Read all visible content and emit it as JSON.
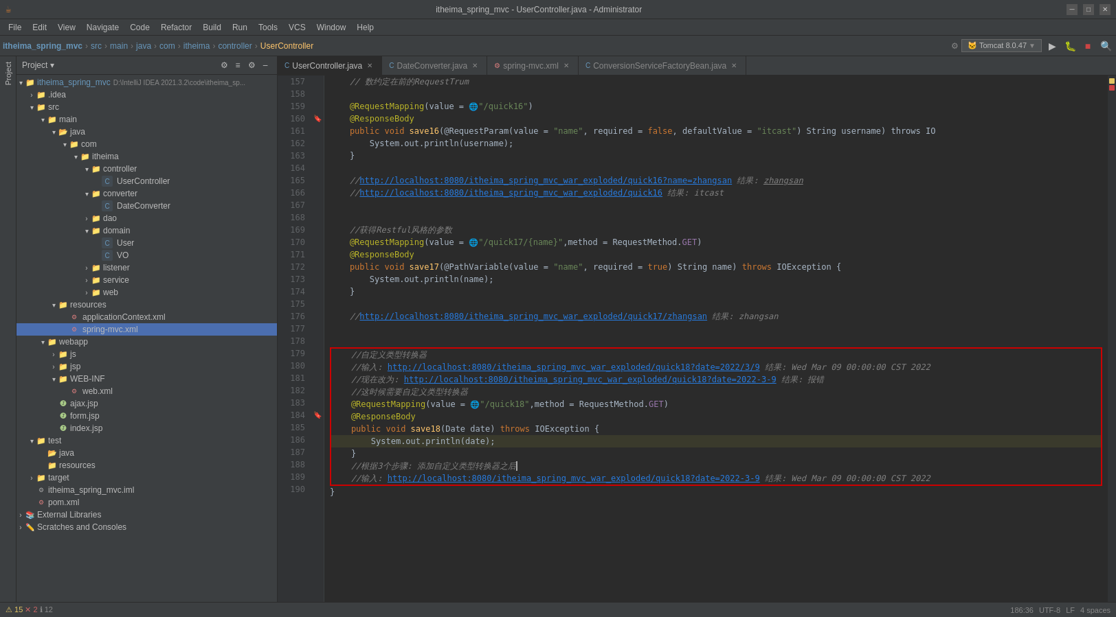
{
  "titleBar": {
    "title": "itheima_spring_mvc - UserController.java - Administrator",
    "minBtn": "─",
    "maxBtn": "□",
    "closeBtn": "✕"
  },
  "menuBar": {
    "items": [
      "File",
      "Edit",
      "View",
      "Navigate",
      "Code",
      "Refactor",
      "Build",
      "Run",
      "Tools",
      "VCS",
      "Window",
      "Help"
    ]
  },
  "toolbar": {
    "breadcrumb": [
      "itheima_spring_mvc",
      "src",
      "main",
      "java",
      "com",
      "itheima",
      "controller",
      "UserController"
    ],
    "tomcat": "Tomcat 8.0.47"
  },
  "sidebar": {
    "title": "Project",
    "tree": [
      {
        "id": "itheima_spring_mvc",
        "label": "itheima_spring_mvc",
        "indent": 0,
        "type": "project",
        "expanded": true,
        "suffix": " D:\\IntelliJ IDEA 2021.3.2\\code\\itheima_sp..."
      },
      {
        "id": "idea",
        "label": ".idea",
        "indent": 1,
        "type": "folder",
        "expanded": false
      },
      {
        "id": "src",
        "label": "src",
        "indent": 1,
        "type": "folder",
        "expanded": true
      },
      {
        "id": "main",
        "label": "main",
        "indent": 2,
        "type": "folder",
        "expanded": true
      },
      {
        "id": "java",
        "label": "java",
        "indent": 3,
        "type": "folder-src",
        "expanded": true
      },
      {
        "id": "com",
        "label": "com",
        "indent": 4,
        "type": "folder",
        "expanded": true
      },
      {
        "id": "itheima",
        "label": "itheima",
        "indent": 5,
        "type": "folder",
        "expanded": true
      },
      {
        "id": "controller",
        "label": "controller",
        "indent": 6,
        "type": "folder",
        "expanded": true
      },
      {
        "id": "UserController",
        "label": "UserController",
        "indent": 7,
        "type": "java-class",
        "selected": false
      },
      {
        "id": "converter",
        "label": "converter",
        "indent": 6,
        "type": "folder",
        "expanded": true
      },
      {
        "id": "DateConverter",
        "label": "DateConverter",
        "indent": 7,
        "type": "java-class"
      },
      {
        "id": "dao",
        "label": "dao",
        "indent": 6,
        "type": "folder",
        "expanded": false
      },
      {
        "id": "domain",
        "label": "domain",
        "indent": 6,
        "type": "folder",
        "expanded": true
      },
      {
        "id": "User",
        "label": "User",
        "indent": 7,
        "type": "java-class"
      },
      {
        "id": "VO",
        "label": "VO",
        "indent": 7,
        "type": "java-class"
      },
      {
        "id": "listener",
        "label": "listener",
        "indent": 6,
        "type": "folder",
        "expanded": false
      },
      {
        "id": "service",
        "label": "service",
        "indent": 6,
        "type": "folder",
        "expanded": false
      },
      {
        "id": "web",
        "label": "web",
        "indent": 6,
        "type": "folder",
        "expanded": false
      },
      {
        "id": "resources",
        "label": "resources",
        "indent": 3,
        "type": "folder-res",
        "expanded": true
      },
      {
        "id": "applicationContext",
        "label": "applicationContext.xml",
        "indent": 4,
        "type": "xml"
      },
      {
        "id": "spring-mvc",
        "label": "spring-mvc.xml",
        "indent": 4,
        "type": "xml",
        "selected": true
      },
      {
        "id": "webapp",
        "label": "webapp",
        "indent": 2,
        "type": "folder",
        "expanded": true
      },
      {
        "id": "js",
        "label": "js",
        "indent": 3,
        "type": "folder",
        "expanded": false
      },
      {
        "id": "jsp",
        "label": "jsp",
        "indent": 3,
        "type": "folder",
        "expanded": false
      },
      {
        "id": "WEB-INF",
        "label": "WEB-INF",
        "indent": 3,
        "type": "folder",
        "expanded": true
      },
      {
        "id": "web.xml",
        "label": "web.xml",
        "indent": 4,
        "type": "xml"
      },
      {
        "id": "ajax.jsp",
        "label": "ajax.jsp",
        "indent": 3,
        "type": "jsp"
      },
      {
        "id": "form.jsp",
        "label": "form.jsp",
        "indent": 3,
        "type": "jsp"
      },
      {
        "id": "index.jsp",
        "label": "index.jsp",
        "indent": 3,
        "type": "jsp"
      },
      {
        "id": "test",
        "label": "test",
        "indent": 1,
        "type": "folder",
        "expanded": true
      },
      {
        "id": "test-java",
        "label": "java",
        "indent": 2,
        "type": "folder-src"
      },
      {
        "id": "test-resources",
        "label": "resources",
        "indent": 2,
        "type": "folder-res"
      },
      {
        "id": "target",
        "label": "target",
        "indent": 1,
        "type": "folder",
        "expanded": false
      },
      {
        "id": "itheima_spring_mvc.iml",
        "label": "itheima_spring_mvc.iml",
        "indent": 1,
        "type": "iml"
      },
      {
        "id": "pom.xml",
        "label": "pom.xml",
        "indent": 1,
        "type": "xml"
      },
      {
        "id": "External Libraries",
        "label": "External Libraries",
        "indent": 0,
        "type": "folder",
        "expanded": false
      },
      {
        "id": "Scratches",
        "label": "Scratches and Consoles",
        "indent": 0,
        "type": "folder",
        "expanded": false
      }
    ]
  },
  "tabs": [
    {
      "id": "UserController",
      "label": "UserController.java",
      "type": "java",
      "active": true,
      "modified": false
    },
    {
      "id": "DateConverter",
      "label": "DateConverter.java",
      "type": "java",
      "active": false,
      "modified": false
    },
    {
      "id": "spring-mvc",
      "label": "spring-mvc.xml",
      "type": "xml",
      "active": false,
      "modified": false
    },
    {
      "id": "ConversionServiceFactoryBean",
      "label": "ConversionServiceFactoryBean.java",
      "type": "java",
      "active": false,
      "modified": false
    }
  ],
  "codeLines": [
    {
      "num": 157,
      "code": "    // 数约定在前的RequestTrum",
      "type": "comment",
      "gutter": ""
    },
    {
      "num": 158,
      "code": "",
      "type": "empty",
      "gutter": ""
    },
    {
      "num": 159,
      "code": "    @RequestMapping(value = \"/quick16\")",
      "type": "code",
      "gutter": ""
    },
    {
      "num": 160,
      "code": "    @ResponseBody",
      "type": "code",
      "gutter": "bookmark"
    },
    {
      "num": 161,
      "code": "    public void save16(@RequestParam(value = \"name\", required = false, defaultValue = \"itcast\") String username) throws IO",
      "type": "code",
      "gutter": ""
    },
    {
      "num": 162,
      "code": "        System.out.println(username);",
      "type": "code",
      "gutter": ""
    },
    {
      "num": 163,
      "code": "    }",
      "type": "code",
      "gutter": ""
    },
    {
      "num": 164,
      "code": "",
      "type": "empty",
      "gutter": ""
    },
    {
      "num": 165,
      "code": "    //http://localhost:8080/itheima_spring_mvc_war_exploded/quick16?name=zhangsan 结果: zhangsan",
      "type": "comment-url",
      "gutter": ""
    },
    {
      "num": 166,
      "code": "    //http://localhost:8080/itheima_spring_mvc_war_exploded/quick16 结果: itcast",
      "type": "comment-url",
      "gutter": ""
    },
    {
      "num": 167,
      "code": "",
      "type": "empty",
      "gutter": ""
    },
    {
      "num": 168,
      "code": "",
      "type": "empty",
      "gutter": ""
    },
    {
      "num": 169,
      "code": "    //获得Restful风格的参数",
      "type": "comment",
      "gutter": ""
    },
    {
      "num": 170,
      "code": "    @RequestMapping(value = \"/quick17/{name}\",method = RequestMethod.GET)",
      "type": "code",
      "gutter": ""
    },
    {
      "num": 171,
      "code": "    @ResponseBody",
      "type": "code",
      "gutter": ""
    },
    {
      "num": 172,
      "code": "    public void save17(@PathVariable(value = \"name\", required = true) String name) throws IOException {",
      "type": "code",
      "gutter": ""
    },
    {
      "num": 173,
      "code": "        System.out.println(name);",
      "type": "code",
      "gutter": ""
    },
    {
      "num": 174,
      "code": "    }",
      "type": "code",
      "gutter": ""
    },
    {
      "num": 175,
      "code": "",
      "type": "empty",
      "gutter": ""
    },
    {
      "num": 176,
      "code": "    //http://localhost:8080/itheima_spring_mvc_war_exploded/quick17/zhangsan 结果: zhangsan",
      "type": "comment-url",
      "gutter": ""
    },
    {
      "num": 177,
      "code": "",
      "type": "empty",
      "gutter": ""
    },
    {
      "num": 178,
      "code": "",
      "type": "empty",
      "gutter": ""
    },
    {
      "num": 179,
      "code": "    //自定义类型转换器",
      "type": "comment",
      "gutter": ""
    },
    {
      "num": 180,
      "code": "    //输入: http://localhost:8080/itheima_spring_mvc_war_exploded/quick18?date=2022/3/9 结果: Wed Mar 09 00:00:00 CST 2022",
      "type": "comment-url-red",
      "gutter": ""
    },
    {
      "num": 181,
      "code": "    //现在改为: http://localhost:8080/itheima_spring_mvc_war_exploded/quick18?date=2022-3-9 结果: 报错",
      "type": "comment-url-red",
      "gutter": ""
    },
    {
      "num": 182,
      "code": "    //这时候需要自定义类型转换器",
      "type": "comment-red",
      "gutter": ""
    },
    {
      "num": 183,
      "code": "    @RequestMapping(value = \"/quick18\",method = RequestMethod.GET)",
      "type": "code-red",
      "gutter": ""
    },
    {
      "num": 184,
      "code": "    @ResponseBody",
      "type": "code-red",
      "gutter": "bookmark"
    },
    {
      "num": 185,
      "code": "    public void save18(Date date) throws IOException {",
      "type": "code-red",
      "gutter": ""
    },
    {
      "num": 186,
      "code": "        System.out.println(date);",
      "type": "code-red",
      "gutter": ""
    },
    {
      "num": 187,
      "code": "    }",
      "type": "code-red",
      "gutter": ""
    },
    {
      "num": 188,
      "code": "    //根据3个步骤: 添加自定义类型转换器之后|",
      "type": "comment-red-cursor",
      "gutter": ""
    },
    {
      "num": 189,
      "code": "    //输入: http://localhost:8080/itheima_spring_mvc_war_exploded/quick18?date=2022-3-9 结果: Wed Mar 09 00:00:00 CST 2022",
      "type": "comment-url-red",
      "gutter": ""
    },
    {
      "num": 190,
      "code": "}",
      "type": "code",
      "gutter": ""
    }
  ],
  "statusBar": {
    "warnings": "15",
    "errors": "2",
    "info": "12",
    "position": "186:36",
    "encoding": "UTF-8",
    "lineEnding": "LF",
    "indent": "4 spaces"
  }
}
